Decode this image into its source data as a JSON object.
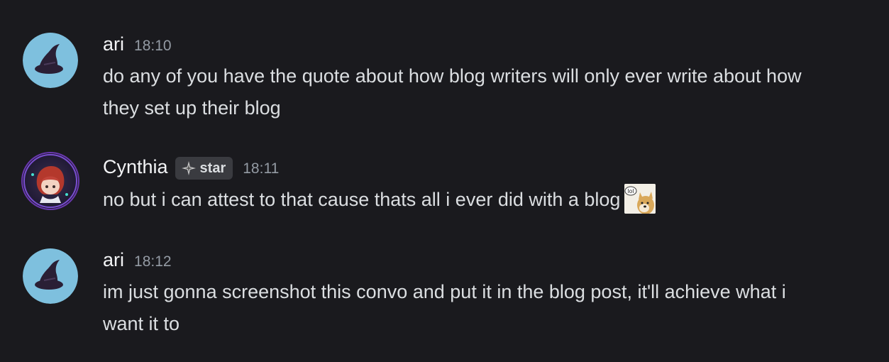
{
  "messages": [
    {
      "author": "ari",
      "timestamp": "18:10",
      "text": "do any of you have the quote about how blog writers will only ever write about how they set up their blog",
      "avatar_icon": "witch-hat-icon"
    },
    {
      "author": "Cynthia",
      "timestamp": "18:11",
      "badge": "star",
      "badge_icon": "sparkle-icon",
      "text": "no but i can attest to that cause thats all i ever did with a blog",
      "avatar_icon": "anime-avatar",
      "emoji_icon": "doge-lol-emoji",
      "emoji_text": "lol"
    },
    {
      "author": "ari",
      "timestamp": "18:12",
      "text": "im just gonna screenshot this convo and put it in the blog post, it'll achieve what i want it to",
      "avatar_icon": "witch-hat-icon"
    }
  ],
  "colors": {
    "background": "#1a1a1e",
    "username": "#f2f3f5",
    "timestamp": "#949ba4",
    "text": "#dbdee1",
    "avatar_bg": "#7ec0de",
    "badge_bg": "#3a3b40"
  }
}
